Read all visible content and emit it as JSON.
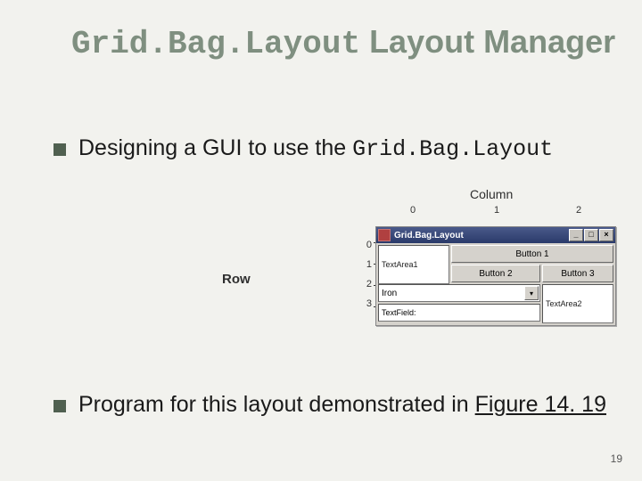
{
  "title": {
    "mono": "Grid.Bag.Layout",
    "rest": " Layout Manager"
  },
  "bullets": [
    {
      "pre": "Designing a GUI to use the ",
      "mono": "Grid.Bag.Layout"
    }
  ],
  "bullet2": {
    "pre": "Program for this layout demonstrated in ",
    "link": "Figure 14. 19"
  },
  "figure": {
    "column_label": "Column",
    "row_label": "Row",
    "col_indices": [
      "0",
      "1",
      "2"
    ],
    "row_indices": [
      "0",
      "1",
      "2",
      "3"
    ],
    "window_title": "Grid.Bag.Layout",
    "components": {
      "textarea1": "TextArea1",
      "button1": "Button 1",
      "button2": "Button 2",
      "button3": "Button 3",
      "combo_item": "Iron",
      "textfield": "TextField:",
      "textarea2": "TextArea2"
    }
  },
  "page_number": "19"
}
